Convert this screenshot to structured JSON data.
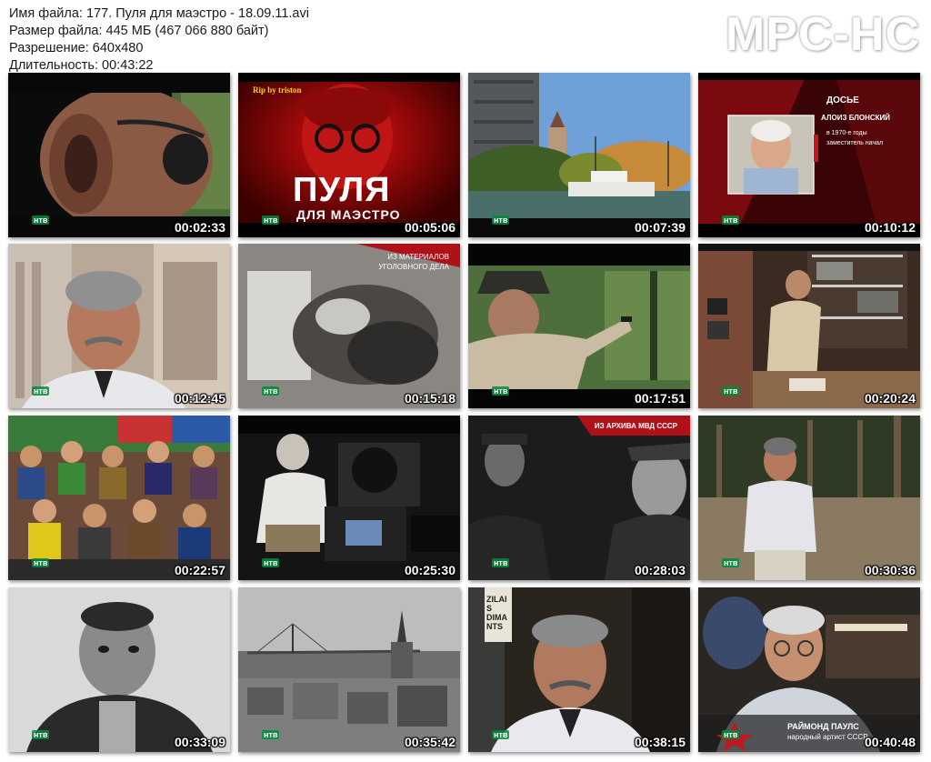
{
  "file_info": {
    "name": "Имя файла: 177. Пуля для маэстро - 18.09.11.avi",
    "size": "Размер файла: 445 МБ (467 066 880 байт)",
    "resolution": "Разрешение: 640x480",
    "duration": "Длительность: 00:43:22"
  },
  "logo": "MPC-HC",
  "channel_logo": "нтв",
  "thumbnails": [
    {
      "time": "00:02:33"
    },
    {
      "time": "00:05:06",
      "rip": "Rip by triston",
      "title1": "ПУЛЯ",
      "title2": "ДЛЯ МАЭСТРО"
    },
    {
      "time": "00:07:39"
    },
    {
      "time": "00:10:12",
      "dossier": "ДОСЬЕ",
      "name": "АЛОИЗ БЛОНСКИЙ",
      "line1": "в 1970-е годы",
      "line2": "заместитель начал"
    },
    {
      "time": "00:12:45"
    },
    {
      "time": "00:15:18",
      "cap1": "ИЗ МАТЕРИАЛОВ",
      "cap2": "УГОЛОВНОГО ДЕЛА"
    },
    {
      "time": "00:17:51"
    },
    {
      "time": "00:20:24"
    },
    {
      "time": "00:22:57"
    },
    {
      "time": "00:25:30"
    },
    {
      "time": "00:28:03",
      "archive": "ИЗ АРХИВА МВД СССР"
    },
    {
      "time": "00:30:36"
    },
    {
      "time": "00:33:09"
    },
    {
      "time": "00:35:42"
    },
    {
      "time": "00:38:15",
      "sign": "ZILAIS DIMANTS"
    },
    {
      "time": "00:40:48",
      "person": "РАЙМОНД ПАУЛС",
      "role": "народный артист СССР"
    }
  ]
}
